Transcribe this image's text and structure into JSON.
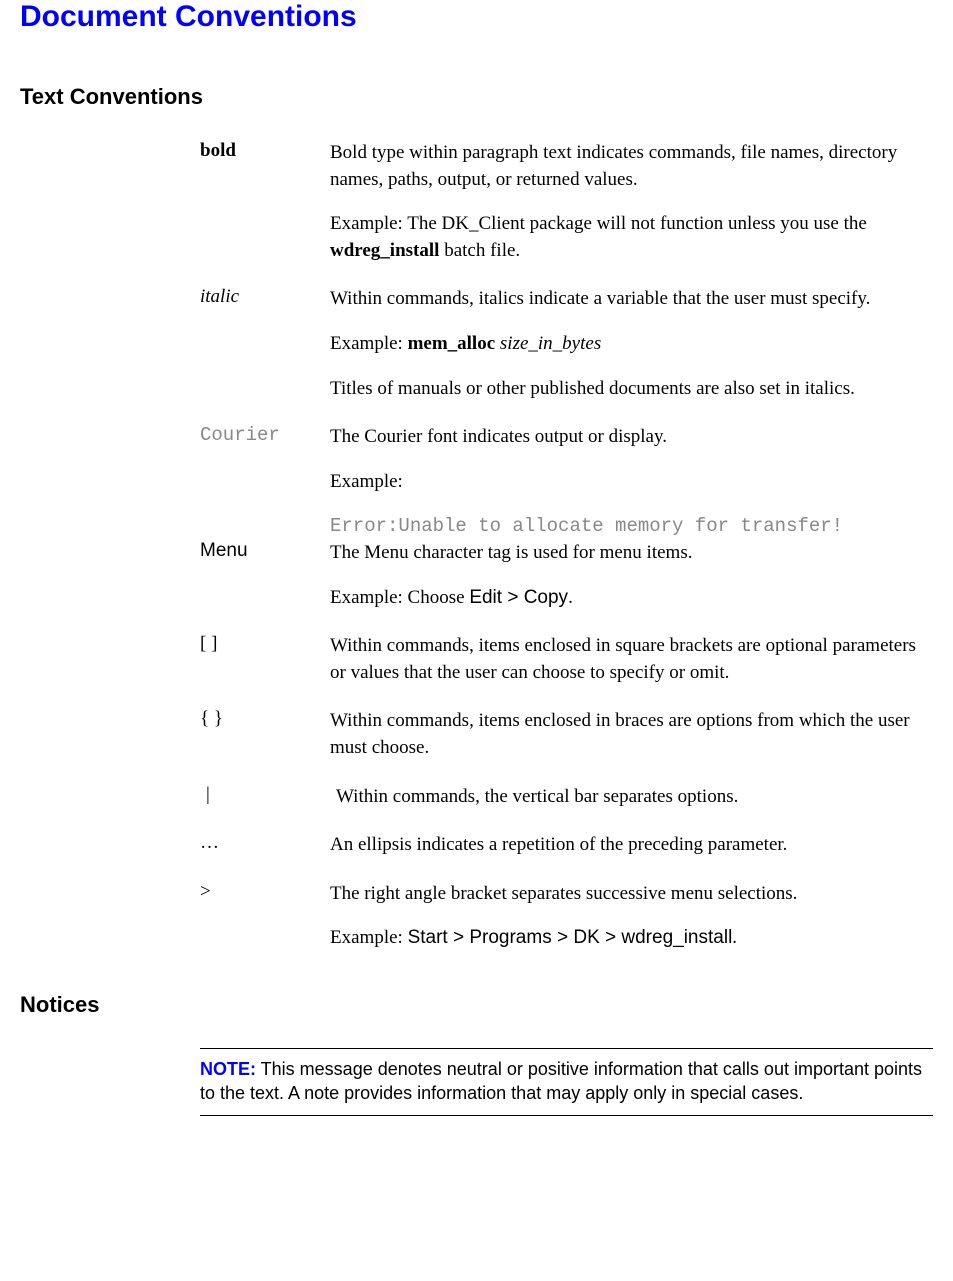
{
  "title": "Document Conventions",
  "sections": {
    "text_conventions": {
      "heading": "Text Conventions",
      "rows": {
        "bold": {
          "label": "bold",
          "p1": "Bold type within paragraph text indicates commands, file names, directory names, paths, output, or returned values.",
          "p2a": "Example: The DK_Client package will not function unless you use the ",
          "p2b_bold": "wdreg_install",
          "p2c": " batch file."
        },
        "italic": {
          "label": "italic",
          "p1": "Within commands, italics indicate a variable that the user must specify.",
          "p2a": "Example: ",
          "p2b_bold": "mem_alloc",
          "p2c_space": " ",
          "p2d_italic": "size_in_bytes",
          "p3": "Titles of manuals or other published documents are also set in italics."
        },
        "courier": {
          "label": "Courier",
          "p1": "The Courier font indicates output or display.",
          "p2": "Example:",
          "p3_code": "Error:Unable to allocate memory for transfer!"
        },
        "menu": {
          "label": "Menu",
          "p1": "The Menu character tag is used for menu items.",
          "p2a": "Example: Choose ",
          "p2b_menu": "Edit > Copy",
          "p2c": "."
        },
        "brackets": {
          "label": "[ ]",
          "p1": "Within commands, items enclosed in square brackets are optional parameters or values that the user can choose to specify or omit."
        },
        "braces": {
          "label": "{ }",
          "p1": "Within commands, items enclosed in braces are options from which the user must choose."
        },
        "pipe": {
          "label": "|",
          "p1": "Within commands, the vertical bar separates options."
        },
        "ellipsis": {
          "label": "…",
          "p1": "An ellipsis indicates a repetition of the preceding parameter."
        },
        "angle": {
          "label": ">",
          "p1": "The right angle bracket separates successive menu selections.",
          "p2a": "Example: ",
          "p2b_menu": "Start > Programs > DK > wdreg_install",
          "p2c": "."
        }
      }
    },
    "notices": {
      "heading": "Notices",
      "note_label": "NOTE:",
      "note_text": " This message denotes neutral or positive information that calls out important points to the text. A note provides information that may apply only in special cases."
    }
  }
}
